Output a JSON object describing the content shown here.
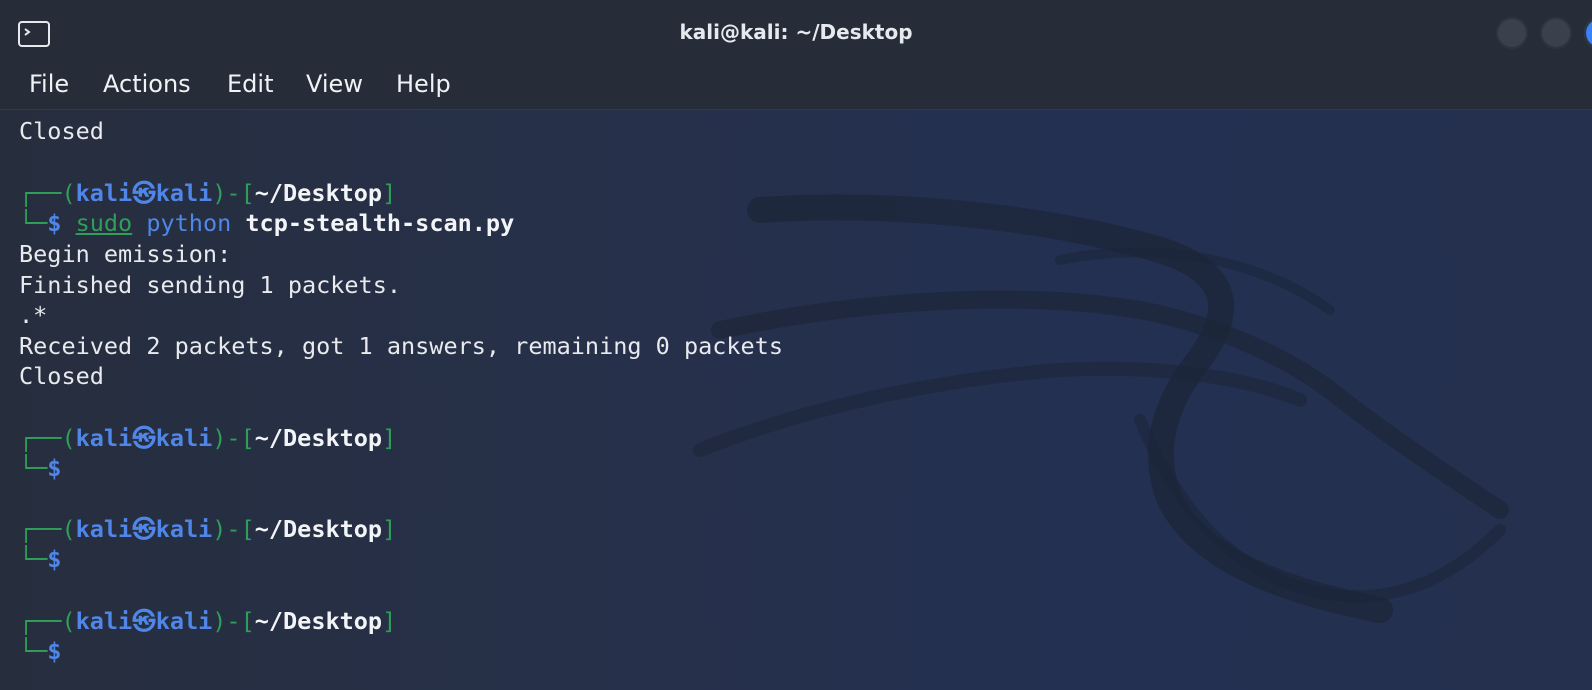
{
  "window": {
    "title": "kali@kali: ~/Desktop",
    "icon": "terminal-icon",
    "controls": [
      "minimize-button",
      "maximize-button",
      "close-button"
    ]
  },
  "menu": {
    "file": "File",
    "actions": "Actions",
    "edit": "Edit",
    "view": "View",
    "help": "Help"
  },
  "terminal": {
    "line1": "Closed",
    "prompt_corner": "┌──(",
    "prompt_user": "kali",
    "prompt_at": "㉿",
    "prompt_host": "kali",
    "prompt_mid": ")-[",
    "prompt_path": "~/Desktop",
    "prompt_close": "]",
    "prompt_arrow": "└─",
    "prompt_dollar": "$",
    "command_sudo": "sudo",
    "command_python": "python",
    "command_file": "tcp-stealth-scan.py",
    "out1": "Begin emission:",
    "out2": "Finished sending 1 packets.",
    "out3": ".*",
    "out4": "Received 2 packets, got 1 answers, remaining 0 packets",
    "out5": "Closed"
  },
  "colors": {
    "prompt_frame": "#2f9e58",
    "prompt_user": "#4f86e8",
    "background": "#232b3b"
  }
}
